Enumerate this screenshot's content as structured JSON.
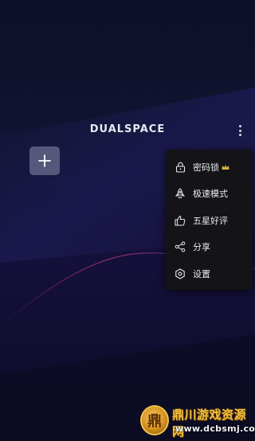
{
  "app": {
    "logo_text": "DUALSPACE"
  },
  "menu": {
    "items": [
      {
        "label": "密码锁",
        "icon": "lock-icon",
        "badge_icon": "crown-icon"
      },
      {
        "label": "极速模式",
        "icon": "rocket-icon"
      },
      {
        "label": "五星好评",
        "icon": "thumbs-up-icon"
      },
      {
        "label": "分享",
        "icon": "share-icon"
      },
      {
        "label": "设置",
        "icon": "settings-icon"
      }
    ]
  },
  "watermark": {
    "title": "鼎川游戏资源网",
    "url": "www.dcbsmj.com",
    "emblem": "鼎"
  },
  "colors": {
    "background": "#0d1027",
    "menu_background": "#141418",
    "add_button": "#55587a",
    "accent_line": "#d23a7a",
    "crown": "#e0b43a"
  }
}
